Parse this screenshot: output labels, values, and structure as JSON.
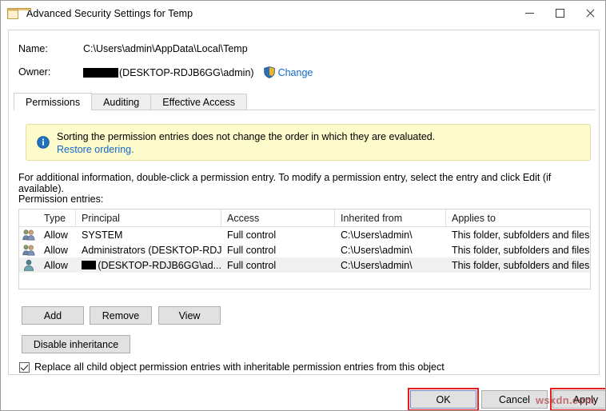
{
  "window": {
    "title": "Advanced Security Settings for Temp",
    "icon": "folder-icon",
    "minimize_label": "–",
    "maximize_label": "□",
    "close_label": "✕"
  },
  "header": {
    "name_label": "Name:",
    "name_value": "C:\\Users\\admin\\AppData\\Local\\Temp",
    "owner_label": "Owner:",
    "owner_redacted": true,
    "owner_value": "(DESKTOP-RDJB6GG\\admin)",
    "change_link": "Change",
    "shield_icon": "uac-shield-icon"
  },
  "tabs": [
    {
      "label": "Permissions",
      "active": true
    },
    {
      "label": "Auditing",
      "active": false
    },
    {
      "label": "Effective Access",
      "active": false
    }
  ],
  "infobar": {
    "icon": "info-icon",
    "text": "Sorting the permission entries does not change the order in which they are evaluated.",
    "link": "Restore ordering.",
    "background": "#fdfacb",
    "border": "#e3dfa2"
  },
  "hint": "For additional information, double-click a permission entry. To modify a permission entry, select the entry and click Edit (if available).",
  "entries_label": "Permission entries:",
  "table": {
    "columns": [
      "",
      "Type",
      "Principal",
      "Access",
      "Inherited from",
      "Applies to"
    ],
    "rows": [
      {
        "icon": "group-icon",
        "type": "Allow",
        "principal": "SYSTEM",
        "principal_redacted": false,
        "access": "Full control",
        "inherited_from": "C:\\Users\\admin\\",
        "applies_to": "This folder, subfolders and files",
        "selected": false
      },
      {
        "icon": "group-icon",
        "type": "Allow",
        "principal": "Administrators (DESKTOP-RDJ...",
        "principal_redacted": false,
        "access": "Full control",
        "inherited_from": "C:\\Users\\admin\\",
        "applies_to": "This folder, subfolders and files",
        "selected": false
      },
      {
        "icon": "user-icon",
        "type": "Allow",
        "principal": "(DESKTOP-RDJB6GG\\ad...",
        "principal_redacted": true,
        "access": "Full control",
        "inherited_from": "C:\\Users\\admin\\",
        "applies_to": "This folder, subfolders and files",
        "selected": true
      }
    ]
  },
  "buttons": {
    "add": "Add",
    "remove": "Remove",
    "view": "View",
    "disable_inheritance": "Disable inheritance"
  },
  "checkbox": {
    "checked": true,
    "label": "Replace all child object permission entries with inheritable permission entries from this object"
  },
  "footer": {
    "ok": "OK",
    "cancel": "Cancel",
    "apply": "Apply"
  },
  "annotations": {
    "highlight_color": "#e71d1d",
    "highlighted": [
      "OK",
      "Apply"
    ]
  },
  "watermark": "wsxdn.com"
}
